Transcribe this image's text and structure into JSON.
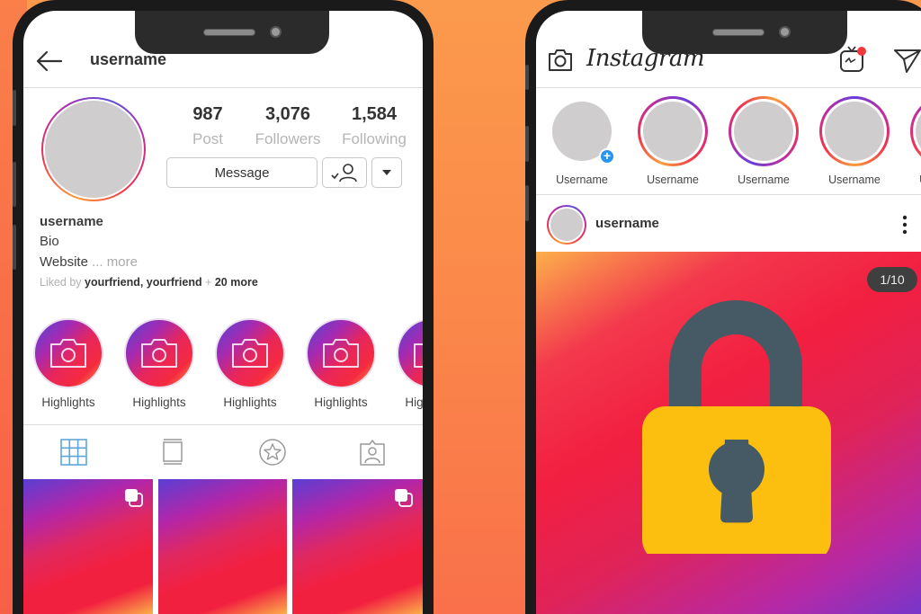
{
  "profile_screen": {
    "header": {
      "title": "username",
      "back_icon": "arrow-left-icon"
    },
    "stats": [
      {
        "value": "987",
        "label": "Post"
      },
      {
        "value": "3,076",
        "label": "Followers"
      },
      {
        "value": "1,584",
        "label": "Following"
      }
    ],
    "buttons": {
      "message": "Message",
      "following_icon": "user-check-icon",
      "dropdown_icon": "caret-down-icon"
    },
    "bio": {
      "name": "username",
      "bio": "Bio",
      "website": "Website",
      "ellipsis": " ... ",
      "more": "more",
      "liked_prefix": "Liked by ",
      "liked_names": "yourfriend, yourfriend",
      "liked_plus": " + ",
      "liked_more": "20 more"
    },
    "highlights": [
      {
        "label": "Highlights",
        "icon": "camera-icon"
      },
      {
        "label": "Highlights",
        "icon": "camera-icon"
      },
      {
        "label": "Highlights",
        "icon": "camera-icon"
      },
      {
        "label": "Highlights",
        "icon": "camera-icon"
      },
      {
        "label": "Highlights",
        "icon": "camera-icon"
      }
    ],
    "tabs": [
      {
        "name": "grid",
        "icon": "grid-icon",
        "active": true
      },
      {
        "name": "reels",
        "icon": "square-icon",
        "active": false
      },
      {
        "name": "guides",
        "icon": "star-icon",
        "active": false
      },
      {
        "name": "tagged",
        "icon": "user-tag-icon",
        "active": false
      }
    ],
    "posts": [
      {
        "multi": true
      },
      {
        "multi": false
      },
      {
        "multi": true
      }
    ]
  },
  "feed_screen": {
    "header": {
      "logo": "Instagram",
      "camera_icon": "camera-icon",
      "igtv_icon": "igtv-icon",
      "direct_icon": "paper-plane-icon"
    },
    "stories": [
      {
        "label": "Username",
        "own": true
      },
      {
        "label": "Username",
        "own": false
      },
      {
        "label": "Username",
        "own": false
      },
      {
        "label": "Username",
        "own": false
      },
      {
        "label": "Username",
        "own": false
      }
    ],
    "post": {
      "username": "username",
      "counter": "1/10",
      "media_icon": "padlock-icon"
    }
  },
  "colors": {
    "background": "#fb8a4a",
    "phone_frame": "#1a1a1a",
    "active_tab": "#5ea6d6",
    "lock_body": "#fdbf0f",
    "lock_shackle": "#455a64",
    "story_plus": "#2a95ef",
    "igtv_dot": "#f2383a"
  }
}
